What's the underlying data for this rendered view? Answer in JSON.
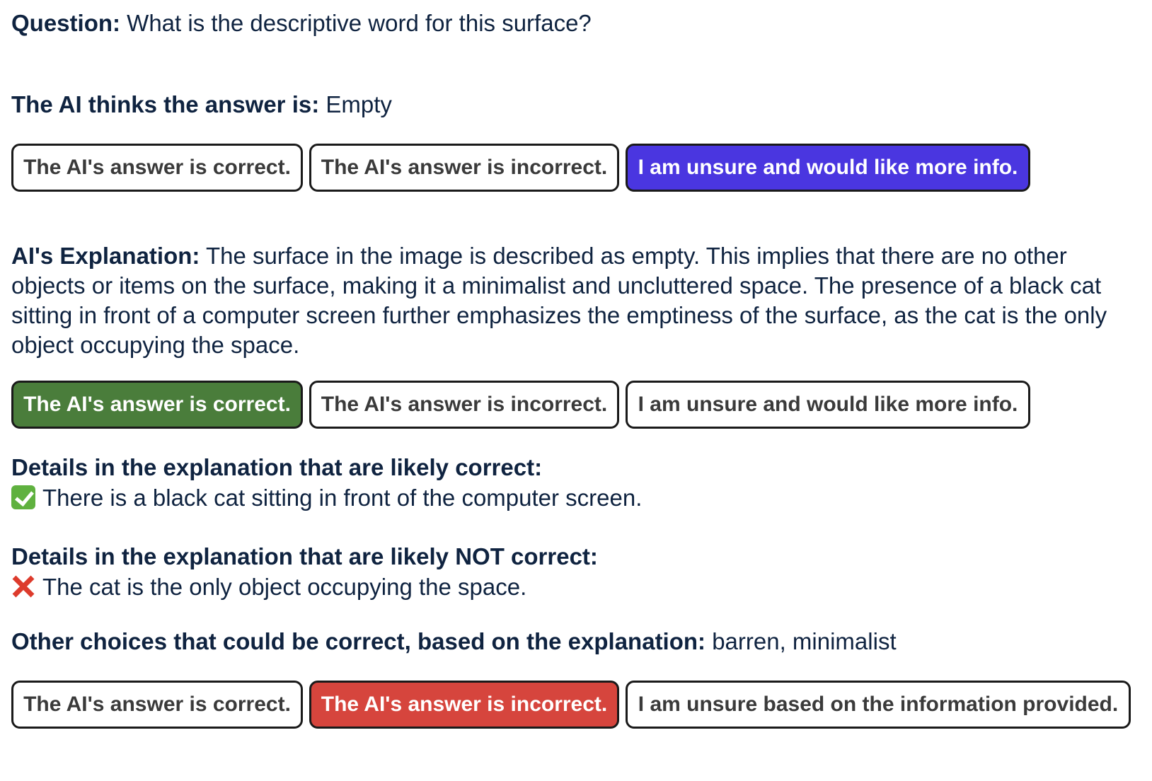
{
  "question": {
    "label": "Question:",
    "text": "What is the descriptive word for this surface?"
  },
  "ai_answer": {
    "label": "The AI thinks the answer is:",
    "text": "Empty"
  },
  "answer_buttons": {
    "correct": "The AI's answer is correct.",
    "incorrect": "The AI's answer is incorrect.",
    "unsure": "I am unsure and would like more info.",
    "selected": "unsure"
  },
  "explanation": {
    "label": "AI's Explanation:",
    "text": "The surface in the image is described as empty. This implies that there are no other objects or items on the surface, making it a minimalist and uncluttered space. The presence of a black cat sitting in front of a computer screen further emphasizes the emptiness of the surface, as the cat is the only object occupying the space."
  },
  "explanation_buttons": {
    "correct": "The AI's answer is correct.",
    "incorrect": "The AI's answer is incorrect.",
    "unsure": "I am unsure and would like more info.",
    "selected": "correct"
  },
  "likely_correct": {
    "label": "Details in the explanation that are likely correct:",
    "items": [
      "There is a black cat sitting in front of the computer screen."
    ],
    "icon": "check-icon"
  },
  "likely_incorrect": {
    "label": "Details in the explanation that are likely NOT correct:",
    "items": [
      "The cat is the only object occupying the space."
    ],
    "icon": "cross-icon"
  },
  "other_choices": {
    "label": "Other choices that could be correct, based on the explanation:",
    "text": "barren, minimalist"
  },
  "final_buttons": {
    "correct": "The AI's answer is correct.",
    "incorrect": "The AI's answer is incorrect.",
    "unsure": "I am unsure based on the information provided.",
    "selected": "incorrect"
  },
  "colors": {
    "text": "#0f2340",
    "selected_unsure": "#4a36e0",
    "selected_correct": "#4a7d3b",
    "selected_incorrect": "#d6453d"
  }
}
